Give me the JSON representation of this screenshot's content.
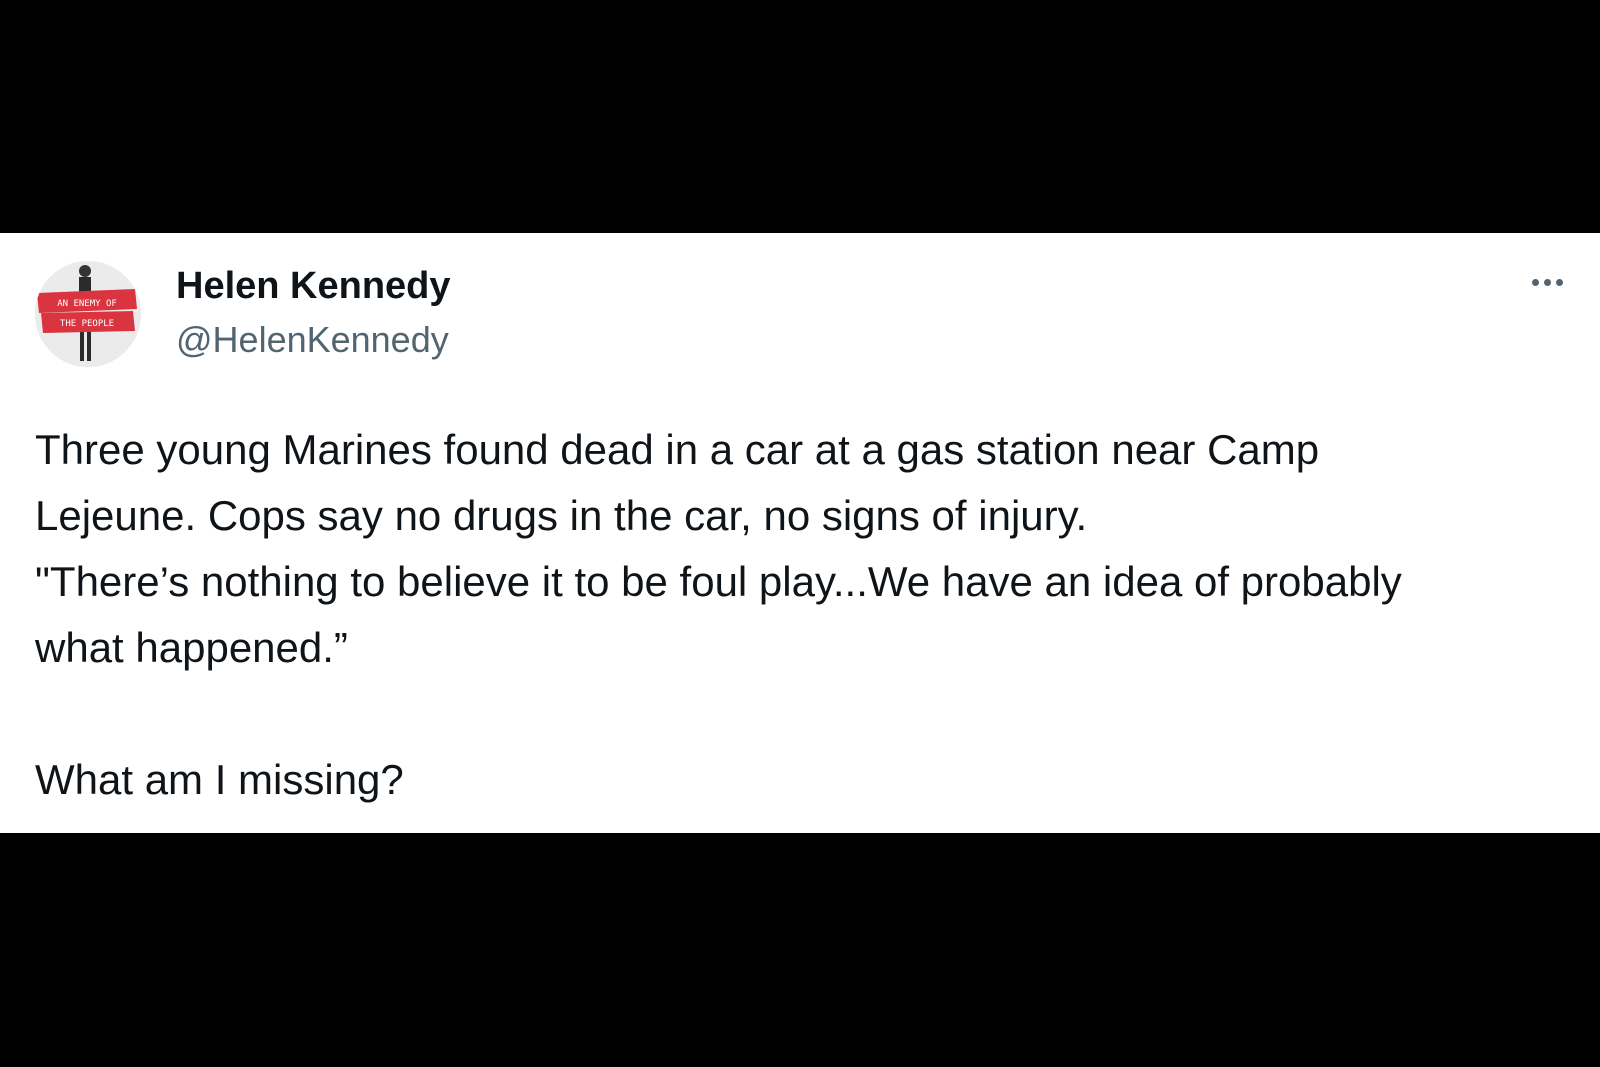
{
  "tweet": {
    "author": {
      "name": "Helen Kennedy",
      "handle": "@HelenKennedy",
      "avatar_icon": "person-holding-sign-avatar",
      "avatar_sign_text": "AN ENEMY OF THE PEOPLE",
      "avatar_sign_color": "#d9343f"
    },
    "more_icon": "more-options-icon",
    "body_lines": [
      "Three young Marines found dead in a car at a gas station near Camp",
      "Lejeune. Cops say no drugs in the car, no signs of injury.",
      "\"There’s nothing to believe it to be foul play...We have an idea of probably",
      "what happened.”"
    ],
    "closing_line": "What am I missing?"
  },
  "colors": {
    "background": "#000000",
    "card": "#ffffff",
    "text_primary": "#0f1419",
    "text_secondary": "#536471"
  }
}
